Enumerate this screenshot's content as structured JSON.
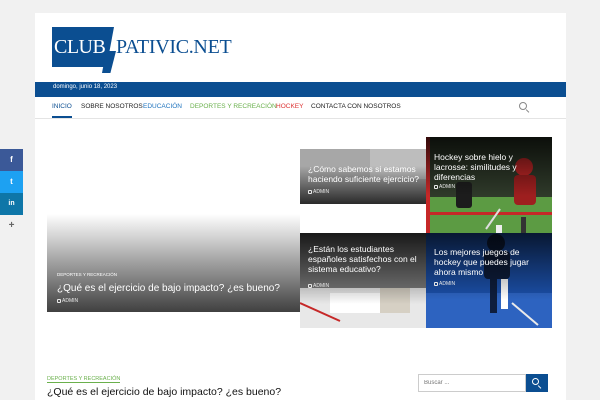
{
  "site": {
    "logo_club": "CLUB",
    "logo_rest": "PATIVIC.NET",
    "date": "domingo, junio 18, 2023",
    "brand_color": "#0b4e91"
  },
  "nav": {
    "items": [
      {
        "label": "INICIO",
        "color": "#0b4e91"
      },
      {
        "label": "SOBRE NOSOTROS",
        "color": "#222222"
      },
      {
        "label": "EDUCACIÓN",
        "color": "#1e73be"
      },
      {
        "label": "DEPORTES Y RECREACIÓN",
        "color": "#6ab04c"
      },
      {
        "label": "HOCKEY",
        "color": "#dd3333"
      },
      {
        "label": "CONTACTA CON NOSOTROS",
        "color": "#222222"
      }
    ],
    "search_icon": "search-icon"
  },
  "featured": {
    "big": {
      "category": "DEPORTES Y RECREACIÓN",
      "title": "¿Qué es el ejercicio de bajo impacto? ¿es bueno?",
      "author": "ADMIN"
    },
    "tiles": [
      {
        "title": "¿Cómo sabemos si estamos haciendo suficiente ejercicio?",
        "author": "ADMIN"
      },
      {
        "title": "Hockey sobre hielo y lacrosse: similitudes y diferencias",
        "author": "ADMIN"
      },
      {
        "title": "¿Están los estudiantes españoles satisfechos con el sistema educativo?",
        "author": "ADMIN"
      },
      {
        "title": "Los mejores juegos de hockey que puedes jugar ahora mismo",
        "author": "ADMIN"
      }
    ]
  },
  "latest": {
    "category": "DEPORTES Y RECREACIÓN",
    "title": "¿Qué es el ejercicio de bajo impacto? ¿es bueno?"
  },
  "sidebar_search": {
    "placeholder": "Buscar ..."
  },
  "social": {
    "facebook": "f",
    "twitter": "t",
    "linkedin": "in",
    "more": "+"
  }
}
